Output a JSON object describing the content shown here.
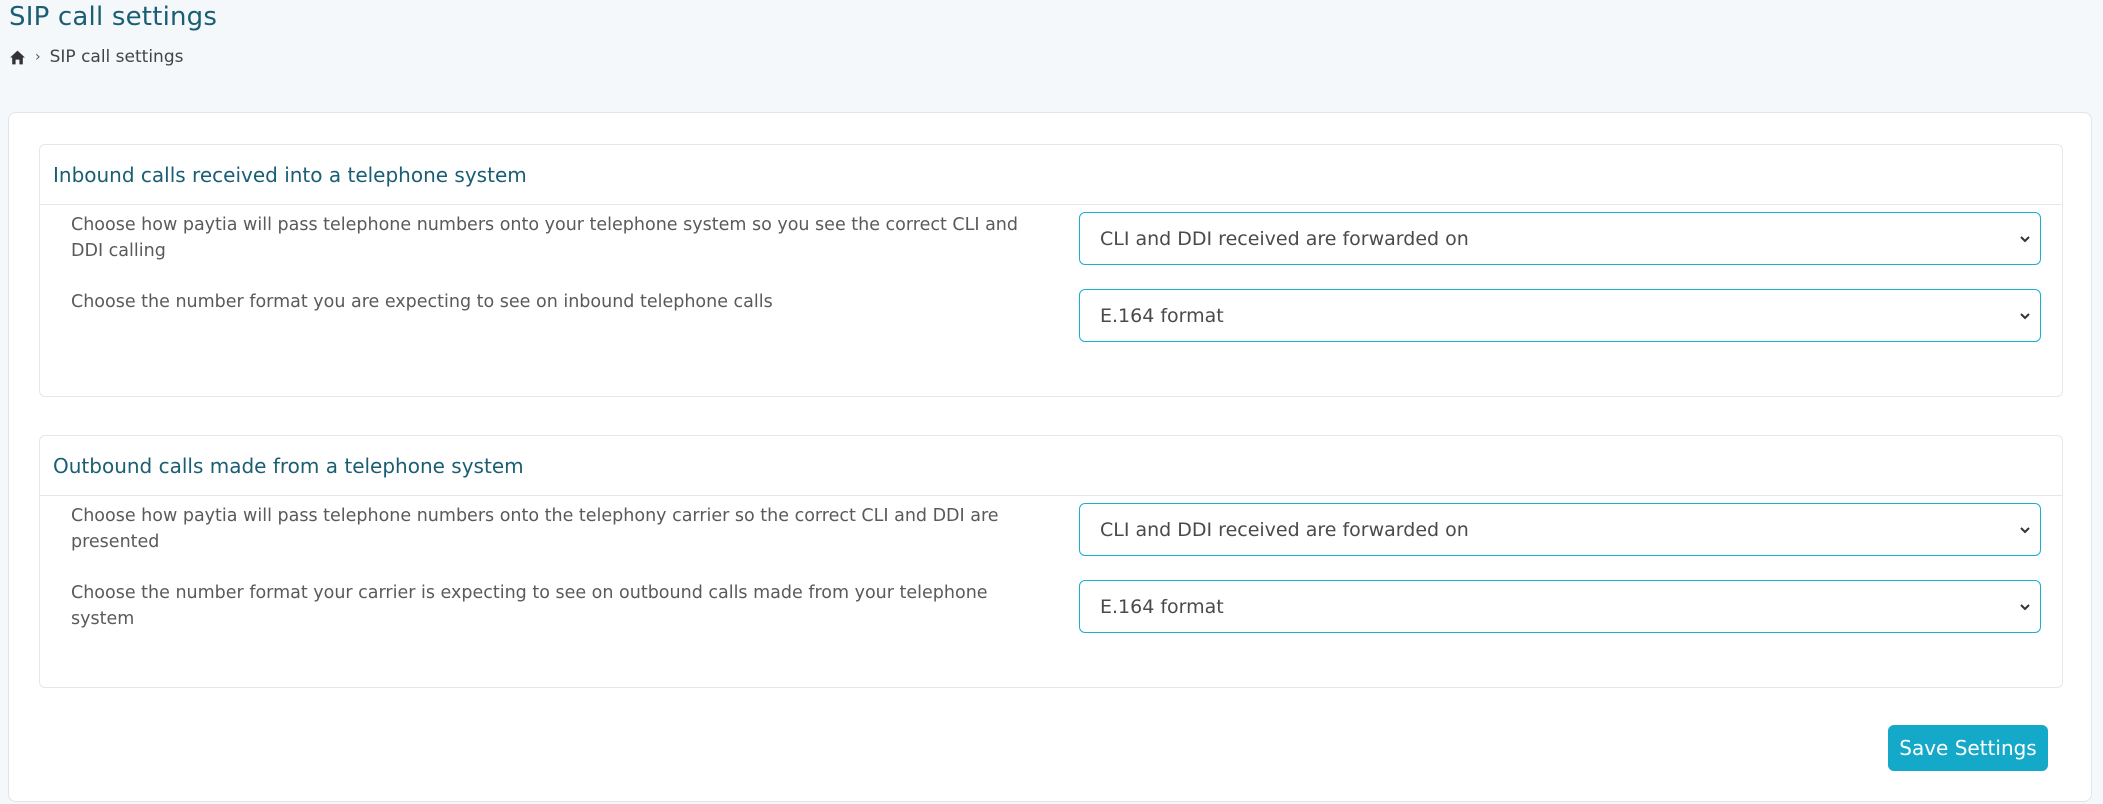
{
  "page": {
    "title": "SIP call settings",
    "breadcrumb": {
      "home_icon": "home-icon",
      "current": "SIP call settings"
    }
  },
  "inbound": {
    "heading": "Inbound calls received into a telephone system",
    "cli_label": "Choose how paytia will pass telephone numbers onto your telephone system so you see the correct CLI and DDI calling",
    "cli_value": "CLI and DDI received are forwarded on",
    "format_label": "Choose the number format you are expecting to see on inbound telephone calls",
    "format_value": "E.164 format"
  },
  "outbound": {
    "heading": "Outbound calls made from a telephone system",
    "cli_label": "Choose how paytia will pass telephone numbers onto the telephony carrier so the correct CLI and DDI are presented",
    "cli_value": "CLI and DDI received are forwarded on",
    "format_label": "Choose the number format your carrier is expecting to see on outbound calls made from your telephone system",
    "format_value": "E.164 format"
  },
  "actions": {
    "save_label": "Save Settings"
  },
  "colors": {
    "accent": "#14a9c9",
    "heading": "#1a5e74",
    "select_border": "#17b0cf"
  }
}
